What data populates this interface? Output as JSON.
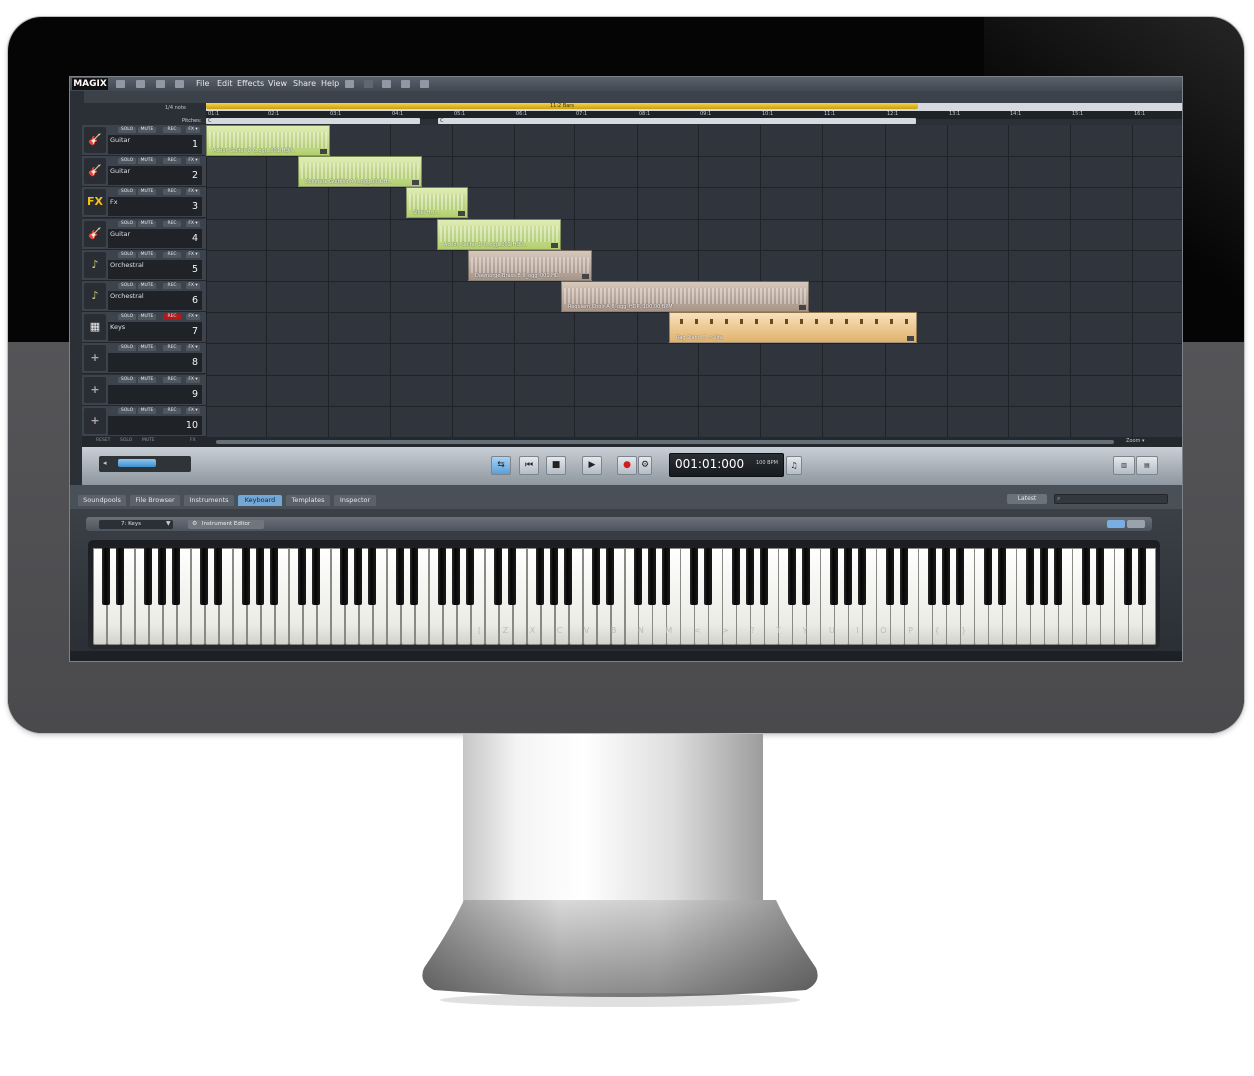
{
  "app": {
    "logo": "MAGIX",
    "menu": [
      "File",
      "Edit",
      "Effects",
      "View",
      "Share",
      "Help"
    ]
  },
  "timeline": {
    "note_value": "1/4 note",
    "pitches_label": "Pitches:",
    "range_label": "11:2 Bars",
    "bar_markers": [
      "01:1",
      "02:1",
      "03:1",
      "04:1",
      "05:1",
      "06:1",
      "07:1",
      "08:1",
      "09:1",
      "10:1",
      "11:1",
      "12:1",
      "13:1",
      "14:1",
      "15:1",
      "16:1"
    ],
    "pitch_segments": [
      "C",
      "C"
    ]
  },
  "tracks": [
    {
      "name": "Guitar",
      "number": "1",
      "icon": "guitar-icon"
    },
    {
      "name": "Guitar",
      "number": "2",
      "icon": "guitar-icon"
    },
    {
      "name": "Fx",
      "number": "3",
      "icon": "fx-icon"
    },
    {
      "name": "Guitar",
      "number": "4",
      "icon": "guitar-icon"
    },
    {
      "name": "Orchestral",
      "number": "5",
      "icon": "saxophone-icon"
    },
    {
      "name": "Orchestral",
      "number": "6",
      "icon": "saxophone-icon"
    },
    {
      "name": "Keys",
      "number": "7",
      "icon": "keyboard-instrument-icon"
    },
    {
      "name": "",
      "number": "8",
      "icon": "add-instrument-icon"
    },
    {
      "name": "",
      "number": "9",
      "icon": "add-instrument-icon"
    },
    {
      "name": "",
      "number": "10",
      "icon": "add-instrument-icon"
    }
  ],
  "track_buttons": {
    "solo": "SOLO",
    "mute": "MUTE",
    "rec": "REC",
    "fx": "FX ▾"
  },
  "footer_buttons": {
    "reset": "RESET",
    "solo": "SOLO",
    "mute": "MUTE",
    "fx": "FX"
  },
  "clips": [
    {
      "label": "Action Guitar D 6_ogg_001.HDP...",
      "color": "green"
    },
    {
      "label": "Concrete Guitfish A 6_ogg_001.H...",
      "color": "green"
    },
    {
      "label": "Slide H_o...",
      "color": "green"
    },
    {
      "label": "Action Guitar D 6_ogg_002.HDP...",
      "color": "green"
    },
    {
      "label": "Dawnorge Brass B 6_ogg_001.HD...",
      "color": "brown"
    },
    {
      "label": "Requiem Choir A 6_ogg_HDP, 100,00 BPM",
      "color": "brown"
    },
    {
      "label": "Rag Piano 6 ->Vita",
      "color": "orange"
    }
  ],
  "transport": {
    "time": "001:01:000",
    "bpm": "100 BPM",
    "zoom_label": "Zoom ▾"
  },
  "lower_tabs": [
    "Soundpools",
    "File Browser",
    "Instruments",
    "Keyboard",
    "Templates",
    "Inspector"
  ],
  "active_lower_tab": "Keyboard",
  "latest_button": "Latest",
  "keyboard_panel": {
    "instrument": "7: Keys",
    "instrument_editor": "Instrument Editor",
    "key_hints": "[ Z X C V B N M < > ? T Y U I O P { }"
  }
}
